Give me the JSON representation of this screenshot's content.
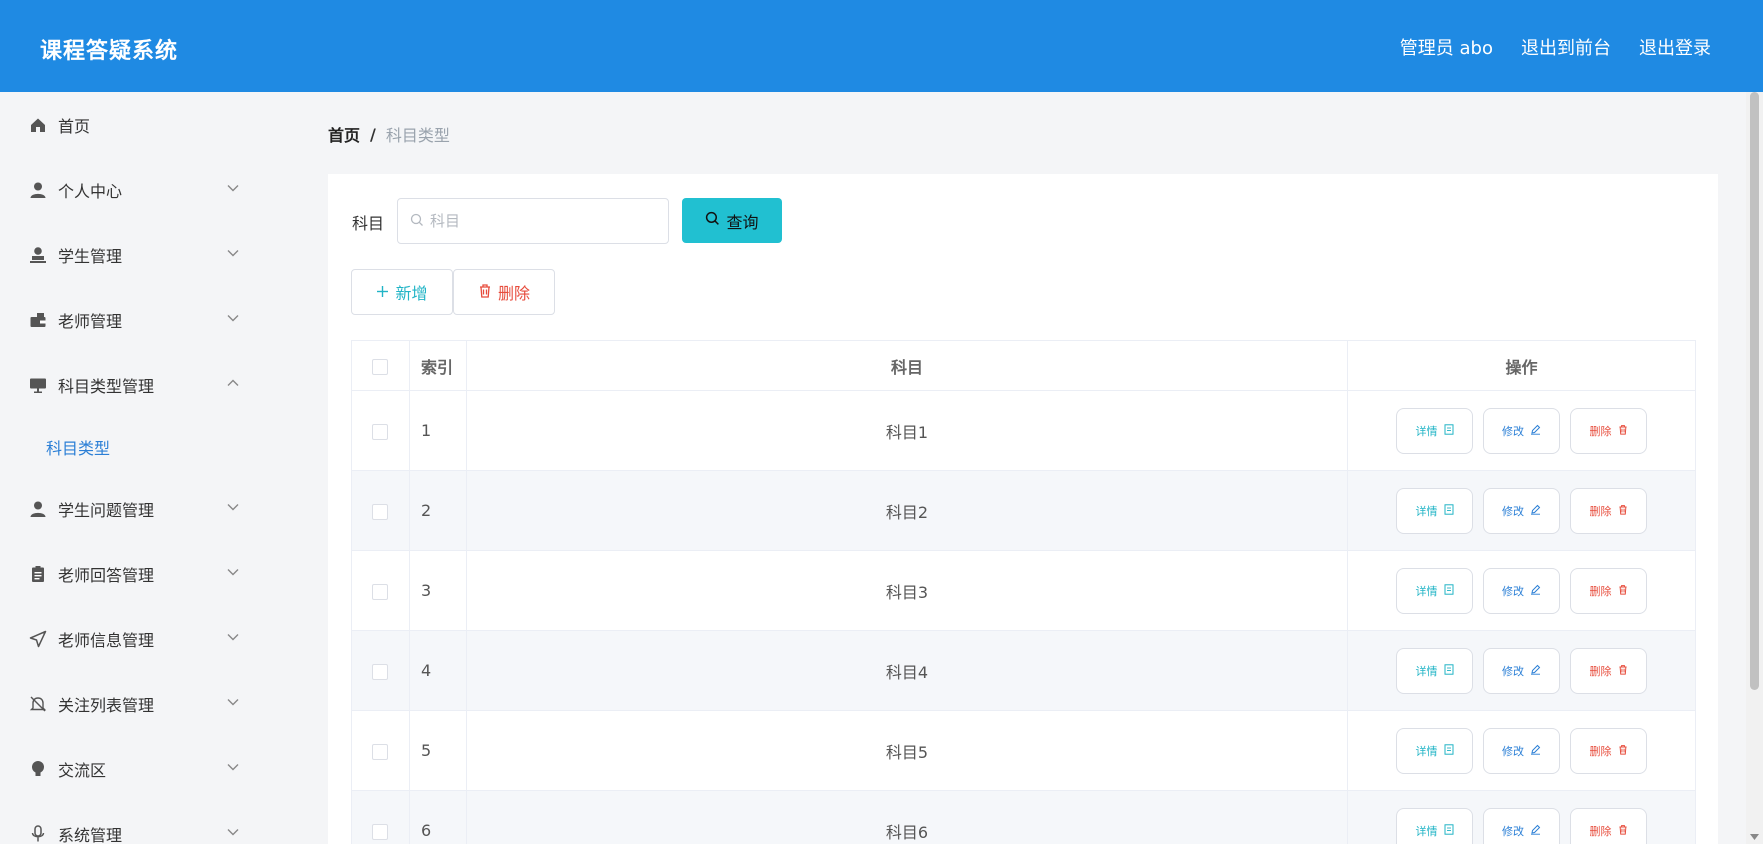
{
  "header": {
    "title": "课程答疑系统",
    "admin_label": "管理员 abo",
    "to_front_label": "退出到前台",
    "logout_label": "退出登录"
  },
  "sidebar": {
    "items": [
      {
        "label": "首页",
        "icon": "home-icon"
      },
      {
        "label": "个人中心",
        "icon": "user-icon"
      },
      {
        "label": "学生管理",
        "icon": "student-icon"
      },
      {
        "label": "老师管理",
        "icon": "wallet-icon"
      },
      {
        "label": "科目类型管理",
        "icon": "monitor-icon",
        "expanded": true
      },
      {
        "label": "学生问题管理",
        "icon": "user-icon"
      },
      {
        "label": "老师回答管理",
        "icon": "clipboard-icon"
      },
      {
        "label": "老师信息管理",
        "icon": "send-icon"
      },
      {
        "label": "关注列表管理",
        "icon": "bell-off-icon"
      },
      {
        "label": "交流区",
        "icon": "bulb-icon"
      },
      {
        "label": "系统管理",
        "icon": "microphone-icon"
      }
    ],
    "subitem": {
      "label": "科目类型"
    }
  },
  "breadcrumb": {
    "home": "首页",
    "separator": "/",
    "current": "科目类型"
  },
  "search": {
    "label": "科目",
    "placeholder": "科目",
    "value": "",
    "button_label": "查询"
  },
  "actions": {
    "add_label": "新增",
    "delete_label": "删除"
  },
  "table": {
    "headers": {
      "index": "索引",
      "subject": "科目",
      "ops": "操作"
    },
    "rows": [
      {
        "index": "1",
        "subject": "科目1"
      },
      {
        "index": "2",
        "subject": "科目2"
      },
      {
        "index": "3",
        "subject": "科目3"
      },
      {
        "index": "4",
        "subject": "科目4"
      },
      {
        "index": "5",
        "subject": "科目5"
      },
      {
        "index": "6",
        "subject": "科目6"
      }
    ],
    "row_ops": {
      "detail": "详情",
      "edit": "修改",
      "delete": "删除"
    }
  },
  "colors": {
    "header_bg": "#1f8ae3",
    "accent_cyan": "#21c0d1",
    "link_blue": "#2b7fd6",
    "danger_red": "#e74c3c"
  }
}
